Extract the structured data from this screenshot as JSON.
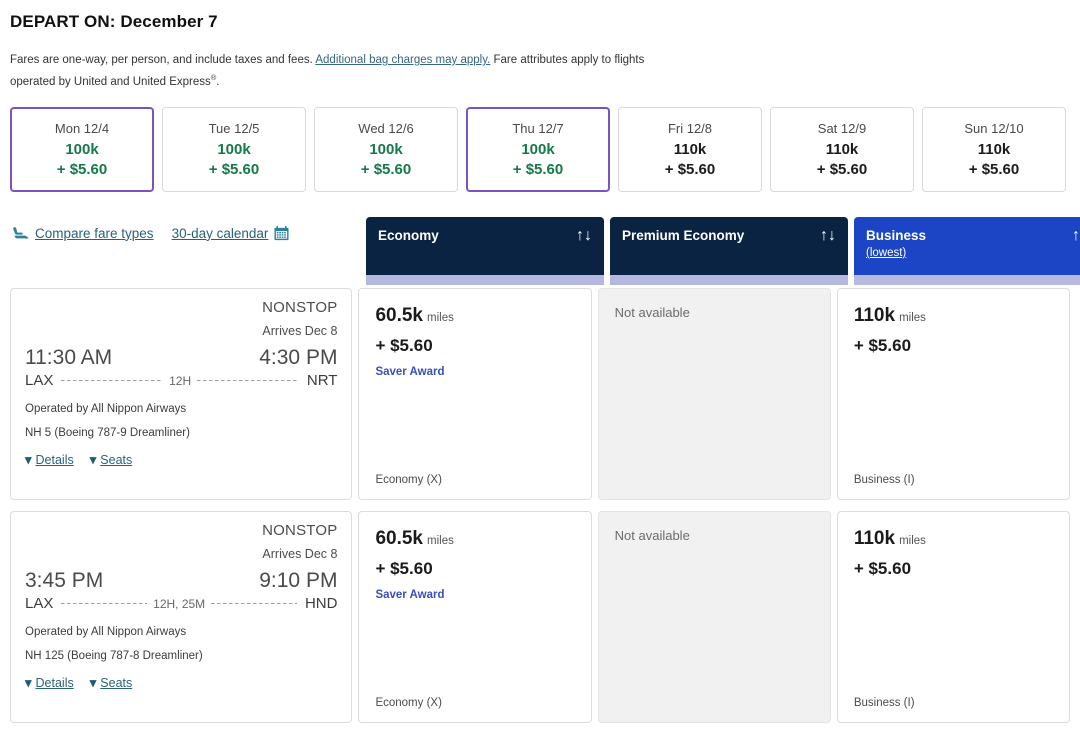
{
  "header": {
    "depart_label": "DEPART ON:",
    "depart_date": "December 7",
    "note_part1": "Fares are one-way, per person, and include taxes and fees. ",
    "note_link": "Additional bag charges may apply.",
    "note_part2": " Fare attributes apply to flights operated by United and United Express",
    "note_sup": "®",
    "note_part3": "."
  },
  "date_strip": [
    {
      "day": "Mon 12/4",
      "miles": "100k",
      "tax": "+ $5.60",
      "selected": true,
      "tone": "green"
    },
    {
      "day": "Tue 12/5",
      "miles": "100k",
      "tax": "+ $5.60",
      "selected": false,
      "tone": "green"
    },
    {
      "day": "Wed 12/6",
      "miles": "100k",
      "tax": "+ $5.60",
      "selected": false,
      "tone": "green"
    },
    {
      "day": "Thu 12/7",
      "miles": "100k",
      "tax": "+ $5.60",
      "selected": true,
      "tone": "green"
    },
    {
      "day": "Fri 12/8",
      "miles": "110k",
      "tax": "+ $5.60",
      "selected": false,
      "tone": "dark"
    },
    {
      "day": "Sat 12/9",
      "miles": "110k",
      "tax": "+ $5.60",
      "selected": false,
      "tone": "dark"
    },
    {
      "day": "Sun 12/10",
      "miles": "110k",
      "tax": "+ $5.60",
      "selected": false,
      "tone": "dark"
    }
  ],
  "links": {
    "compare_fare_types": "Compare fare types",
    "thirty_day_calendar": "30-day calendar",
    "seat_icon": "seat-icon",
    "calendar_icon": "calendar-icon"
  },
  "columns": [
    {
      "title": "Economy",
      "sub": "",
      "sort_icon": "sort-up-down-arrows",
      "sort_glyph": "↑↓",
      "style": "navy"
    },
    {
      "title": "Premium Economy",
      "sub": "",
      "sort_icon": "sort-up-down-arrows",
      "sort_glyph": "↑↓",
      "style": "navy"
    },
    {
      "title": "Business",
      "sub": "(lowest)",
      "sort_icon": "sort-up-arrow",
      "sort_glyph": "↑",
      "style": "blue"
    }
  ],
  "colors": {
    "selected_border": "#7b52c4",
    "green_price": "#15794a",
    "navy_header": "#0b2343",
    "blue_header": "#1b45c4",
    "header_strip": "#b4b8de",
    "link": "#2a6179",
    "saver_badge": "#3a4fbb"
  },
  "flights": [
    {
      "stops": "NONSTOP",
      "arrives": "Arrives Dec 8",
      "depart_time": "11:30 AM",
      "arrive_time": "4:30 PM",
      "origin": "LAX",
      "destination": "NRT",
      "duration": "12H",
      "operated_by": "Operated by All Nippon Airways",
      "equipment": "NH 5 (Boeing 787-9 Dreamliner)",
      "details_label": "Details",
      "seats_label": "Seats",
      "fares": [
        {
          "available": true,
          "miles": "60.5k",
          "unit": "miles",
          "tax": "+ $5.60",
          "badge": "Saver Award",
          "class": "Economy (X)"
        },
        {
          "available": false,
          "unavailable_text": "Not available"
        },
        {
          "available": true,
          "miles": "110k",
          "unit": "miles",
          "tax": "+ $5.60",
          "badge": "",
          "class": "Business (I)"
        }
      ]
    },
    {
      "stops": "NONSTOP",
      "arrives": "Arrives Dec 8",
      "depart_time": "3:45 PM",
      "arrive_time": "9:10 PM",
      "origin": "LAX",
      "destination": "HND",
      "duration": "12H, 25M",
      "operated_by": "Operated by All Nippon Airways",
      "equipment": "NH 125 (Boeing 787-8 Dreamliner)",
      "details_label": "Details",
      "seats_label": "Seats",
      "fares": [
        {
          "available": true,
          "miles": "60.5k",
          "unit": "miles",
          "tax": "+ $5.60",
          "badge": "Saver Award",
          "class": "Economy (X)"
        },
        {
          "available": false,
          "unavailable_text": "Not available"
        },
        {
          "available": true,
          "miles": "110k",
          "unit": "miles",
          "tax": "+ $5.60",
          "badge": "",
          "class": "Business (I)"
        }
      ]
    }
  ]
}
